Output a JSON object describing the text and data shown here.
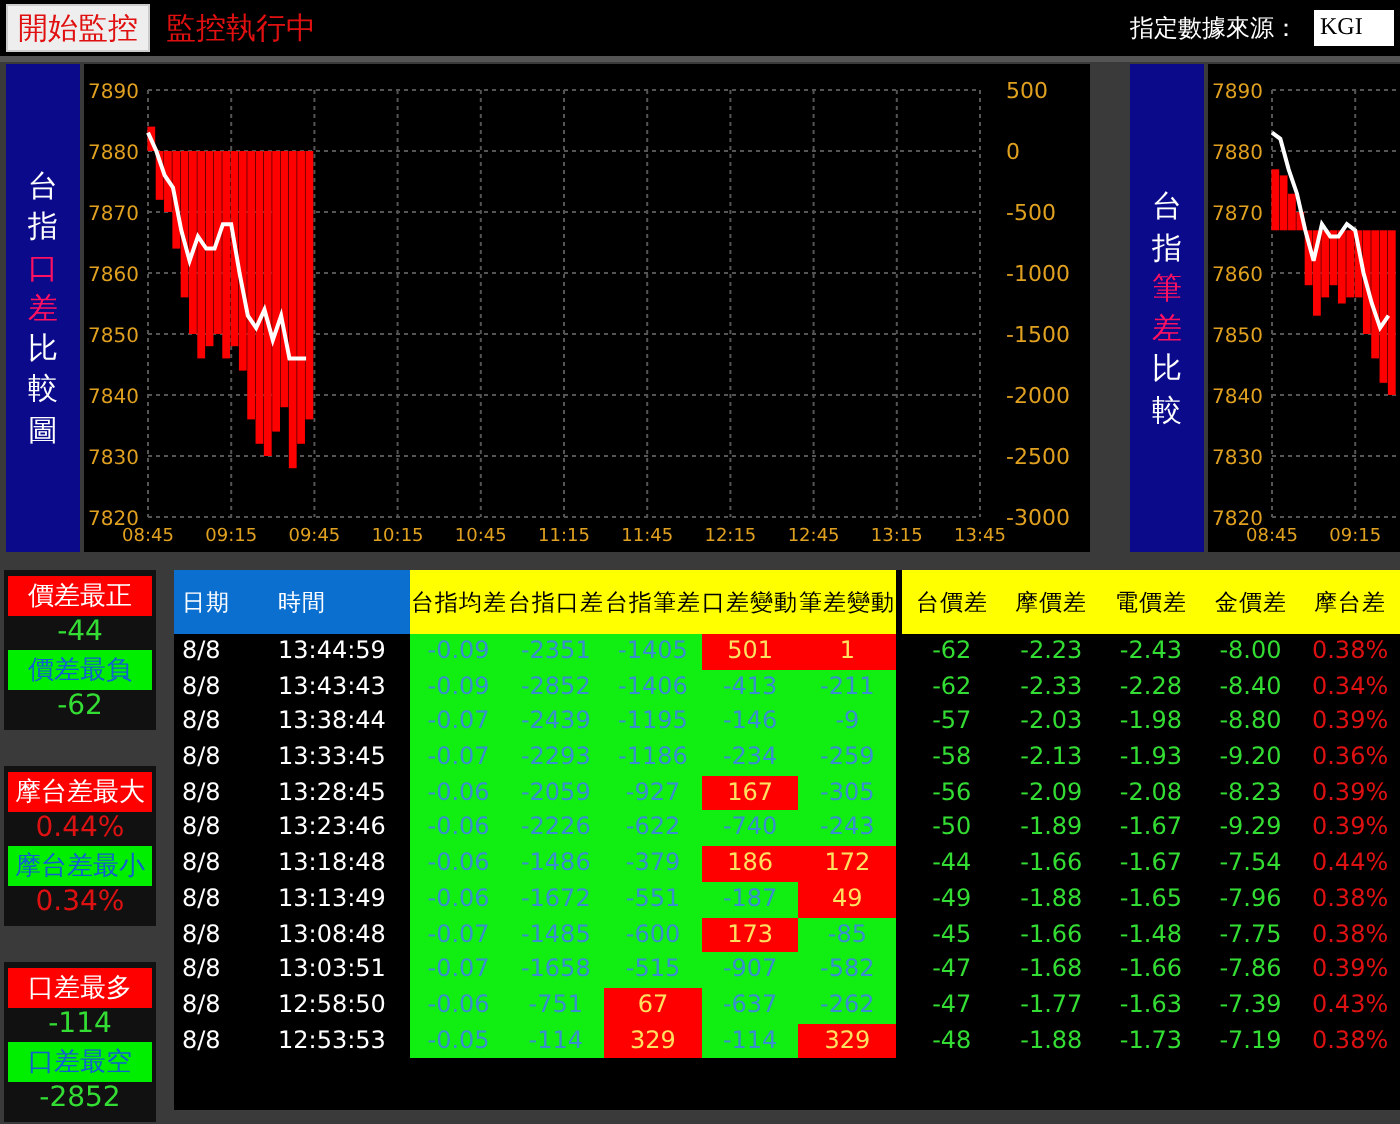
{
  "toolbar": {
    "start_button": "開始監控",
    "status": "監控執行中",
    "source_label": "指定數據來源：",
    "source_value": "KGI"
  },
  "charts": [
    {
      "title_parts": [
        {
          "text": "台指",
          "highlight": false
        },
        {
          "text": "口差",
          "highlight": true
        },
        {
          "text": "比較圖",
          "highlight": false
        }
      ],
      "chart_data": {
        "type": "line",
        "grid": true,
        "categories": [
          "08:45",
          null,
          null,
          null,
          null,
          null,
          null,
          null,
          null,
          null,
          "09:15",
          null,
          null,
          null,
          null,
          null,
          null,
          null,
          null,
          null,
          "09:45",
          null,
          null,
          null,
          null,
          null,
          null,
          null,
          null,
          null,
          "10:15",
          null,
          null,
          null,
          null,
          null,
          null,
          null,
          null,
          null,
          "10:45",
          null,
          null,
          null,
          null,
          null,
          null,
          null,
          null,
          null,
          "11:15",
          null,
          null,
          null,
          null,
          null,
          null,
          null,
          null,
          null,
          "11:45",
          null,
          null,
          null,
          null,
          null,
          null,
          null,
          null,
          null,
          "12:15",
          null,
          null,
          null,
          null,
          null,
          null,
          null,
          null,
          null,
          "12:45",
          null,
          null,
          null,
          null,
          null,
          null,
          null,
          null,
          null,
          "13:15",
          null,
          null,
          null,
          null,
          null,
          null,
          null,
          null,
          null,
          "13:45"
        ],
        "ylim": [
          7820,
          7890
        ],
        "yticks": [
          7890,
          7880,
          7870,
          7860,
          7850,
          7840,
          7830,
          7820
        ],
        "y2lim": [
          -3000,
          500
        ],
        "y2ticks": [
          500,
          0,
          -500,
          -1000,
          -1500,
          -2000,
          -2500,
          -3000
        ],
        "series": [
          {
            "type": "bar",
            "axis": "y2",
            "color": "#ff0000",
            "values": [
              200,
              -400,
              -500,
              -800,
              -1200,
              -1500,
              -1700,
              -1600,
              -1500,
              -1700,
              -1600,
              -1800,
              -2200,
              -2400,
              -2500,
              -2300,
              -2100,
              -2600,
              -2400,
              -2200,
              null,
              null,
              null,
              null,
              null,
              null,
              null,
              null,
              null,
              null,
              null,
              null,
              null,
              null,
              null,
              null,
              null,
              null,
              null,
              null,
              null,
              null,
              null,
              null,
              null,
              null,
              null,
              null,
              null,
              null,
              null,
              null,
              null,
              null,
              null,
              null,
              null,
              null,
              null,
              null,
              null,
              null,
              null,
              null,
              null,
              null,
              null,
              null,
              null,
              null,
              null,
              null,
              null,
              null,
              null,
              null,
              null,
              null,
              null,
              null,
              null,
              null,
              null,
              null,
              null,
              null,
              null,
              null,
              null,
              null,
              null,
              null,
              null,
              null,
              null,
              null,
              null,
              null,
              null,
              null,
              null
            ]
          },
          {
            "color": "#ffffff",
            "values": [
              7883,
              7880,
              7876,
              7874,
              7867,
              7862,
              7866,
              7864,
              7864,
              7868,
              7868,
              7860,
              7853,
              7851,
              7854,
              7849,
              7853,
              7846,
              7846,
              7846,
              null,
              null,
              null,
              null,
              null,
              null,
              null,
              null,
              null,
              null,
              null,
              null,
              null,
              null,
              null,
              null,
              null,
              null,
              null,
              null,
              null,
              null,
              null,
              null,
              null,
              null,
              null,
              null,
              null,
              null,
              null,
              null,
              null,
              null,
              null,
              null,
              null,
              null,
              null,
              null,
              null,
              null,
              null,
              null,
              null,
              null,
              null,
              null,
              null,
              null,
              null,
              null,
              null,
              null,
              null,
              null,
              null,
              null,
              null,
              null,
              null,
              null,
              null,
              null,
              null,
              null,
              null,
              null,
              null,
              null,
              null,
              null,
              null,
              null,
              null,
              null,
              null,
              null,
              null,
              null,
              null
            ]
          }
        ]
      }
    },
    {
      "title_parts": [
        {
          "text": "台指",
          "highlight": false
        },
        {
          "text": "筆差",
          "highlight": true
        },
        {
          "text": "比較",
          "highlight": false
        }
      ],
      "chart_data": {
        "type": "line",
        "grid": true,
        "categories": [
          "08:45",
          null,
          null,
          null,
          null,
          null,
          null,
          null,
          null,
          null,
          "09:15",
          null,
          null,
          null,
          null
        ],
        "ylim": [
          7820,
          7890
        ],
        "yticks": [
          7890,
          7880,
          7870,
          7860,
          7850,
          7840,
          7830,
          7820
        ],
        "series": [
          {
            "type": "bar",
            "color": "#ff0000",
            "base": [
              7867,
              7867,
              7867,
              7867,
              7867,
              7867,
              7867,
              7867,
              7867,
              7867,
              7867,
              7867,
              7867,
              7867,
              7867
            ],
            "values": [
              10,
              9,
              6,
              3,
              -9,
              -14,
              -11,
              -9,
              -12,
              -11,
              -11,
              -17,
              -21,
              -25,
              -27
            ]
          },
          {
            "color": "#ffffff",
            "values": [
              7883,
              7882,
              7877,
              7873,
              7867,
              7862,
              7868,
              7866,
              7866,
              7868,
              7867,
              7860,
              7855,
              7851,
              7853
            ]
          }
        ]
      }
    }
  ],
  "stats": [
    {
      "kind": "points",
      "items": [
        {
          "label": "價差最正",
          "kind": "max",
          "value": "-44"
        },
        {
          "label": "價差最負",
          "kind": "min",
          "value": "-62"
        }
      ]
    },
    {
      "kind": "percent",
      "items": [
        {
          "label": "摩台差最大",
          "kind": "max",
          "value": "0.44%"
        },
        {
          "label": "摩台差最小",
          "kind": "min",
          "value": "0.34%"
        }
      ]
    },
    {
      "kind": "points",
      "items": [
        {
          "label": "口差最多",
          "kind": "max",
          "value": "-114"
        },
        {
          "label": "口差最空",
          "kind": "min",
          "value": "-2852"
        }
      ]
    }
  ],
  "table": {
    "columns": [
      {
        "label": "日期",
        "kind": "info"
      },
      {
        "label": "時間",
        "kind": "info"
      },
      {
        "label": "台指均差",
        "kind": "flag"
      },
      {
        "label": "台指口差",
        "kind": "flag"
      },
      {
        "label": "台指筆差",
        "kind": "flag"
      },
      {
        "label": "口差變動",
        "kind": "flag"
      },
      {
        "label": "筆差變動",
        "kind": "flag"
      },
      {
        "label": "台價差",
        "kind": "price"
      },
      {
        "label": "摩價差",
        "kind": "price"
      },
      {
        "label": "電價差",
        "kind": "price"
      },
      {
        "label": "金價差",
        "kind": "price"
      },
      {
        "label": "摩台差",
        "kind": "percent"
      }
    ],
    "rows": [
      {
        "cells": [
          {
            "value": "8/8"
          },
          {
            "value": "13:44:59"
          },
          {
            "value": "-0.09",
            "alert": false
          },
          {
            "value": "-2351",
            "alert": false
          },
          {
            "value": "-1405",
            "alert": false
          },
          {
            "value": "501",
            "alert": true
          },
          {
            "value": "1",
            "alert": true
          },
          {
            "value": "-62"
          },
          {
            "value": "-2.23"
          },
          {
            "value": "-2.43"
          },
          {
            "value": "-8.00"
          },
          {
            "value": "0.38%"
          }
        ]
      },
      {
        "cells": [
          {
            "value": "8/8"
          },
          {
            "value": "13:43:43"
          },
          {
            "value": "-0.09",
            "alert": false
          },
          {
            "value": "-2852",
            "alert": false
          },
          {
            "value": "-1406",
            "alert": false
          },
          {
            "value": "-413",
            "alert": false
          },
          {
            "value": "-211",
            "alert": false
          },
          {
            "value": "-62"
          },
          {
            "value": "-2.33"
          },
          {
            "value": "-2.28"
          },
          {
            "value": "-8.40"
          },
          {
            "value": "0.34%"
          }
        ]
      },
      {
        "cells": [
          {
            "value": "8/8"
          },
          {
            "value": "13:38:44"
          },
          {
            "value": "-0.07",
            "alert": false
          },
          {
            "value": "-2439",
            "alert": false
          },
          {
            "value": "-1195",
            "alert": false
          },
          {
            "value": "-146",
            "alert": false
          },
          {
            "value": "-9",
            "alert": false
          },
          {
            "value": "-57"
          },
          {
            "value": "-2.03"
          },
          {
            "value": "-1.98"
          },
          {
            "value": "-8.80"
          },
          {
            "value": "0.39%"
          }
        ]
      },
      {
        "cells": [
          {
            "value": "8/8"
          },
          {
            "value": "13:33:45"
          },
          {
            "value": "-0.07",
            "alert": false
          },
          {
            "value": "-2293",
            "alert": false
          },
          {
            "value": "-1186",
            "alert": false
          },
          {
            "value": "-234",
            "alert": false
          },
          {
            "value": "-259",
            "alert": false
          },
          {
            "value": "-58"
          },
          {
            "value": "-2.13"
          },
          {
            "value": "-1.93"
          },
          {
            "value": "-9.20"
          },
          {
            "value": "0.36%"
          }
        ]
      },
      {
        "cells": [
          {
            "value": "8/8"
          },
          {
            "value": "13:28:45"
          },
          {
            "value": "-0.06",
            "alert": false
          },
          {
            "value": "-2059",
            "alert": false
          },
          {
            "value": "-927",
            "alert": false
          },
          {
            "value": "167",
            "alert": true
          },
          {
            "value": "-305",
            "alert": false
          },
          {
            "value": "-56"
          },
          {
            "value": "-2.09"
          },
          {
            "value": "-2.08"
          },
          {
            "value": "-8.23"
          },
          {
            "value": "0.39%"
          }
        ]
      },
      {
        "cells": [
          {
            "value": "8/8"
          },
          {
            "value": "13:23:46"
          },
          {
            "value": "-0.06",
            "alert": false
          },
          {
            "value": "-2226",
            "alert": false
          },
          {
            "value": "-622",
            "alert": false
          },
          {
            "value": "-740",
            "alert": false
          },
          {
            "value": "-243",
            "alert": false
          },
          {
            "value": "-50"
          },
          {
            "value": "-1.89"
          },
          {
            "value": "-1.67"
          },
          {
            "value": "-9.29"
          },
          {
            "value": "0.39%"
          }
        ]
      },
      {
        "cells": [
          {
            "value": "8/8"
          },
          {
            "value": "13:18:48"
          },
          {
            "value": "-0.06",
            "alert": false
          },
          {
            "value": "-1486",
            "alert": false
          },
          {
            "value": "-379",
            "alert": false
          },
          {
            "value": "186",
            "alert": true
          },
          {
            "value": "172",
            "alert": true
          },
          {
            "value": "-44"
          },
          {
            "value": "-1.66"
          },
          {
            "value": "-1.67"
          },
          {
            "value": "-7.54"
          },
          {
            "value": "0.44%"
          }
        ]
      },
      {
        "cells": [
          {
            "value": "8/8"
          },
          {
            "value": "13:13:49"
          },
          {
            "value": "-0.06",
            "alert": false
          },
          {
            "value": "-1672",
            "alert": false
          },
          {
            "value": "-551",
            "alert": false
          },
          {
            "value": "-187",
            "alert": false
          },
          {
            "value": "49",
            "alert": true
          },
          {
            "value": "-49"
          },
          {
            "value": "-1.88"
          },
          {
            "value": "-1.65"
          },
          {
            "value": "-7.96"
          },
          {
            "value": "0.38%"
          }
        ]
      },
      {
        "cells": [
          {
            "value": "8/8"
          },
          {
            "value": "13:08:48"
          },
          {
            "value": "-0.07",
            "alert": false
          },
          {
            "value": "-1485",
            "alert": false
          },
          {
            "value": "-600",
            "alert": false
          },
          {
            "value": "173",
            "alert": true
          },
          {
            "value": "-85",
            "alert": false
          },
          {
            "value": "-45"
          },
          {
            "value": "-1.66"
          },
          {
            "value": "-1.48"
          },
          {
            "value": "-7.75"
          },
          {
            "value": "0.38%"
          }
        ]
      },
      {
        "cells": [
          {
            "value": "8/8"
          },
          {
            "value": "13:03:51"
          },
          {
            "value": "-0.07",
            "alert": false
          },
          {
            "value": "-1658",
            "alert": false
          },
          {
            "value": "-515",
            "alert": false
          },
          {
            "value": "-907",
            "alert": false
          },
          {
            "value": "-582",
            "alert": false
          },
          {
            "value": "-47"
          },
          {
            "value": "-1.68"
          },
          {
            "value": "-1.66"
          },
          {
            "value": "-7.86"
          },
          {
            "value": "0.39%"
          }
        ]
      },
      {
        "cells": [
          {
            "value": "8/8"
          },
          {
            "value": "12:58:50"
          },
          {
            "value": "-0.06",
            "alert": false
          },
          {
            "value": "-751",
            "alert": false
          },
          {
            "value": "67",
            "alert": true
          },
          {
            "value": "-637",
            "alert": false
          },
          {
            "value": "-262",
            "alert": false
          },
          {
            "value": "-47"
          },
          {
            "value": "-1.77"
          },
          {
            "value": "-1.63"
          },
          {
            "value": "-7.39"
          },
          {
            "value": "0.43%"
          }
        ]
      },
      {
        "cells": [
          {
            "value": "8/8"
          },
          {
            "value": "12:53:53"
          },
          {
            "value": "-0.05",
            "alert": false
          },
          {
            "value": "-114",
            "alert": false
          },
          {
            "value": "329",
            "alert": true
          },
          {
            "value": "-114",
            "alert": false
          },
          {
            "value": "329",
            "alert": true
          },
          {
            "value": "-48"
          },
          {
            "value": "-1.88"
          },
          {
            "value": "-1.73"
          },
          {
            "value": "-7.19"
          },
          {
            "value": "0.38%"
          }
        ]
      }
    ]
  }
}
